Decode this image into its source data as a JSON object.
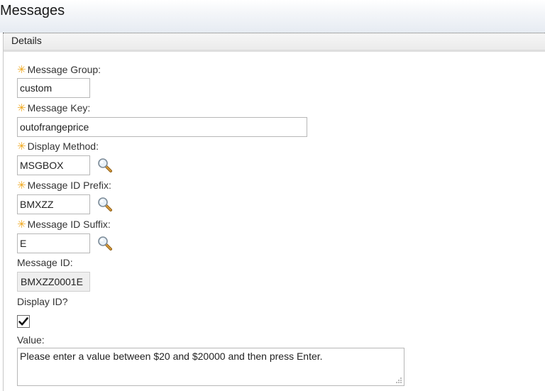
{
  "header": {
    "title": "Messages"
  },
  "section": {
    "title": "Details"
  },
  "form": {
    "message_group": {
      "label": "Message Group:",
      "value": "custom",
      "required": true
    },
    "message_key": {
      "label": "Message Key:",
      "value": "outofrangeprice",
      "required": true
    },
    "display_method": {
      "label": "Display Method:",
      "value": "MSGBOX",
      "required": true,
      "icon": "magnifier-icon"
    },
    "message_id_prefix": {
      "label": "Message ID Prefix:",
      "value": "BMXZZ",
      "required": true,
      "icon": "magnifier-icon"
    },
    "message_id_suffix": {
      "label": "Message ID Suffix:",
      "value": "E",
      "required": true,
      "icon": "magnifier-icon"
    },
    "message_id": {
      "label": "Message ID:",
      "value": "BMXZZ0001E",
      "readonly": true
    },
    "display_id": {
      "label": "Display ID?",
      "checked": true
    },
    "value": {
      "label": "Value:",
      "text": "Please enter a value between $20 and $20000 and then press Enter."
    }
  },
  "colors": {
    "required_asterisk": "#f0a81e",
    "header_gradient_bottom": "#e6ebf2",
    "readonly_bg": "#efefef"
  }
}
